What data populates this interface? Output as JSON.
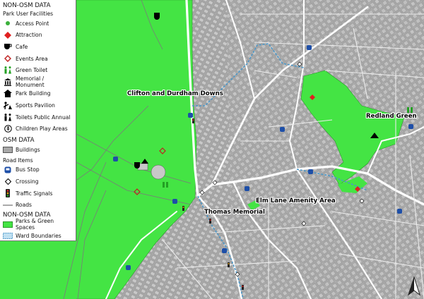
{
  "legend": {
    "heading_non_osm": "NON-OSM DATA",
    "group_park_user_facilities": "Park User Facilities",
    "items_park": [
      {
        "label": "Access Point",
        "icon": "access-point-icon",
        "color": "#3bb03b"
      },
      {
        "label": "Attraction",
        "icon": "attraction-icon",
        "color": "#e02020"
      },
      {
        "label": "Cafe",
        "icon": "cafe-icon",
        "color": "#000000"
      },
      {
        "label": "Events Area",
        "icon": "events-area-icon",
        "color": "#c02020"
      },
      {
        "label": "Green Toilet",
        "icon": "green-toilet-icon",
        "color": "#23a023"
      },
      {
        "label": "Memorial / Monument",
        "icon": "memorial-icon",
        "color": "#000000"
      },
      {
        "label": "Park Building",
        "icon": "park-building-icon",
        "color": "#000000"
      },
      {
        "label": "Sports Pavilion",
        "icon": "sports-pavilion-icon",
        "color": "#000000"
      },
      {
        "label": "Toilets Public Annual",
        "icon": "toilets-icon",
        "color": "#000000"
      },
      {
        "label": "Children Play Areas",
        "icon": "play-area-icon",
        "color": "#000000"
      }
    ],
    "heading_osm": "OSM DATA",
    "item_buildings": "Buildings",
    "group_road_items": "Road Items",
    "items_road": [
      {
        "label": "Bus Stop",
        "icon": "bus-stop-icon",
        "color": "#1e4fa8"
      },
      {
        "label": "Crossing",
        "icon": "crossing-icon",
        "color": "#000000"
      },
      {
        "label": "Traffic Signals",
        "icon": "traffic-signals-icon",
        "color": "#e0a000"
      },
      {
        "label": "Roads",
        "icon": "road-line-icon",
        "color": "#555555"
      }
    ],
    "heading_non_osm_2": "NON-OSM DATA",
    "item_parks": "Parks & Green Spaces",
    "item_wards": "Ward Boundaries"
  },
  "colors": {
    "park": "#44e444",
    "urban": "#a8a8a8",
    "building": "#c6c6c6",
    "road": "#ffffff",
    "ward_boundary": "#4a97c9"
  },
  "map_labels": {
    "clifton_downs": "Clifton and Durdham Downs",
    "redland_green": "Redland Green",
    "elm_lane": "Elm Lane Amenity Area",
    "thomas_memorial": "Thomas Memorial"
  }
}
